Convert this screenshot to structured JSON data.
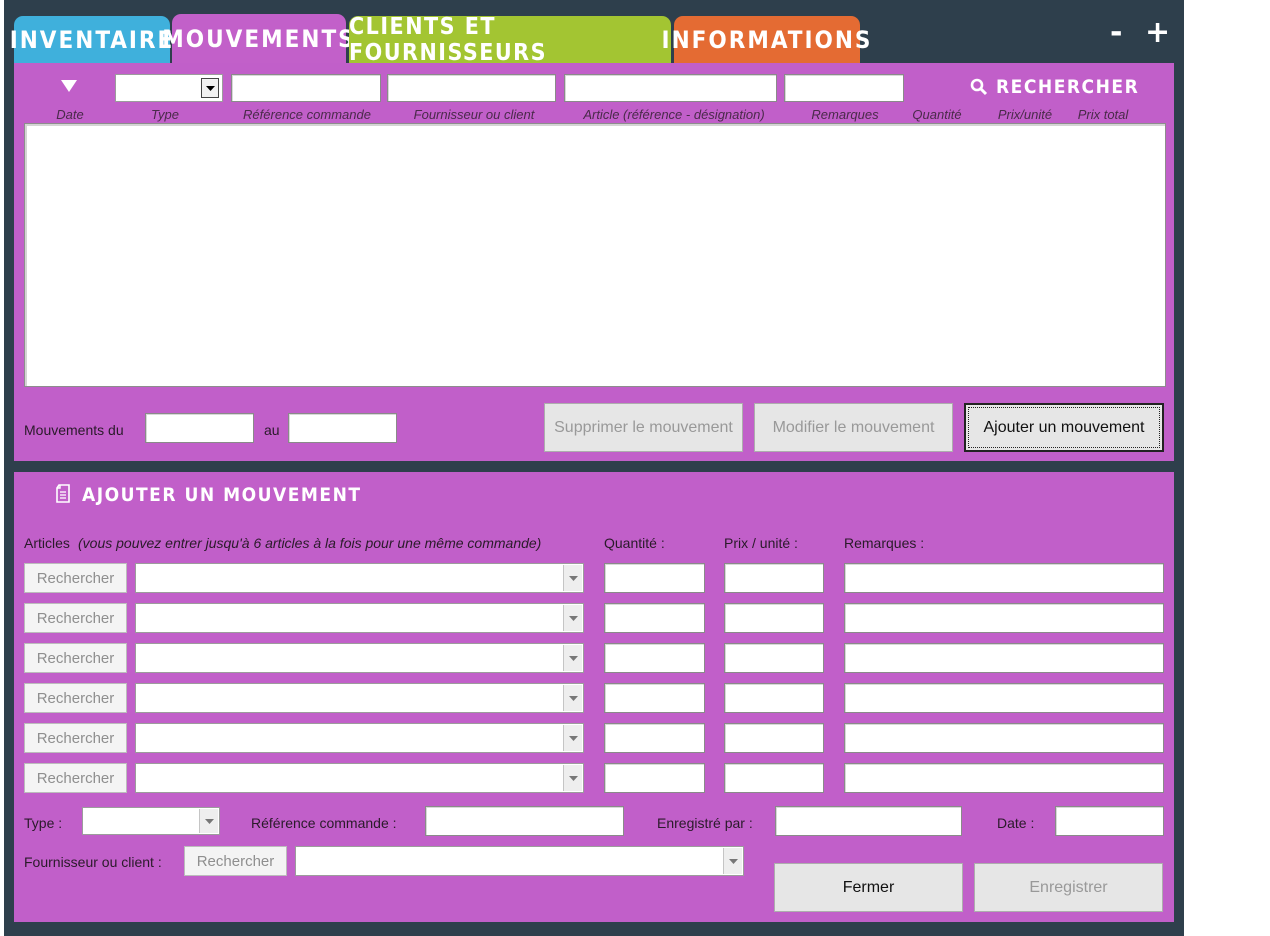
{
  "tabs": {
    "inventaire": "INVENTAIRE",
    "mouvements": "MOUVEMENTS",
    "clients": "CLIENTS ET FOURNISSEURS",
    "informations": "INFORMATIONS"
  },
  "window_controls": {
    "minus": "-",
    "plus": "+"
  },
  "filters": {
    "search_label": "RECHERCHER",
    "columns": [
      "Date",
      "Type",
      "Référence commande",
      "Fournisseur ou client",
      "Article (référence - désignation)",
      "Remarques",
      "Quantité",
      "Prix/unité",
      "Prix total"
    ]
  },
  "period": {
    "from_label": "Mouvements du",
    "to_label": "au"
  },
  "actions": {
    "delete": "Supprimer le mouvement",
    "edit": "Modifier le mouvement",
    "add": "Ajouter un mouvement"
  },
  "form": {
    "title": "AJOUTER UN MOUVEMENT",
    "articles_label": "Articles",
    "articles_hint": "(vous pouvez entrer jusqu'à 6 articles à la fois pour une même commande)",
    "quantity_label": "Quantité :",
    "unit_price_label": "Prix / unité :",
    "remarks_label": "Remarques :",
    "search_button": "Rechercher",
    "type_label": "Type :",
    "order_ref_label": "Référence commande :",
    "recorded_by_label": "Enregistré par :",
    "date_label": "Date :",
    "supplier_label": "Fournisseur ou client :",
    "close_button": "Fermer",
    "save_button": "Enregistrer"
  },
  "colors": {
    "frame": "#2e3f4c",
    "panel": "#c15fc9",
    "tab_inventaire": "#3fb0dc",
    "tab_mouvements": "#c260c9",
    "tab_clients": "#a3c532",
    "tab_informations": "#e46b33"
  }
}
